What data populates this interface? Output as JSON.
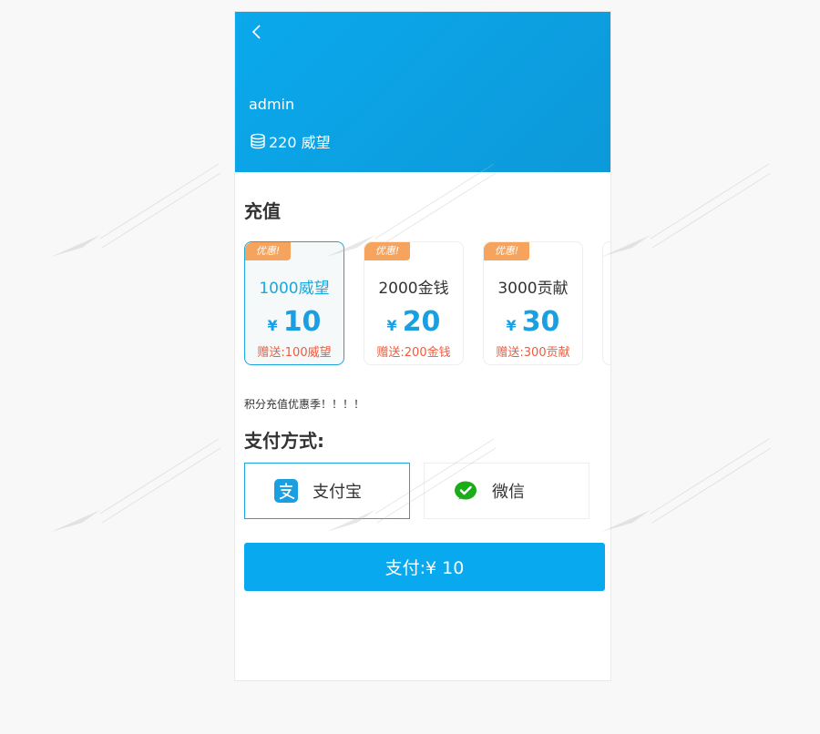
{
  "header": {
    "username": "admin",
    "balance": "220 威望"
  },
  "recharge": {
    "title": "充值",
    "packages": [
      {
        "badge": "优惠!",
        "name": "1000威望",
        "currency": "¥",
        "price": "10",
        "bonus": "赠送:100威望",
        "selected": true
      },
      {
        "badge": "优惠!",
        "name": "2000金钱",
        "currency": "¥",
        "price": "20",
        "bonus": "赠送:200金钱",
        "selected": false
      },
      {
        "badge": "优惠!",
        "name": "3000贡献",
        "currency": "¥",
        "price": "30",
        "bonus": "赠送:300贡献",
        "selected": false
      }
    ],
    "promo": "积分充值优惠季！！！！"
  },
  "payment": {
    "title": "支付方式:",
    "methods": [
      {
        "label": "支付宝",
        "icon": "alipay-icon",
        "selected": true
      },
      {
        "label": "微信",
        "icon": "wechat-icon",
        "selected": false
      }
    ]
  },
  "submit": {
    "label": "支付:¥ 10"
  },
  "colors": {
    "header_bg": "#0aa9ec",
    "accent": "#1a9fe0",
    "badge": "#f6a35d",
    "bonus": "#ef5b3b",
    "button": "#08a9ef"
  }
}
